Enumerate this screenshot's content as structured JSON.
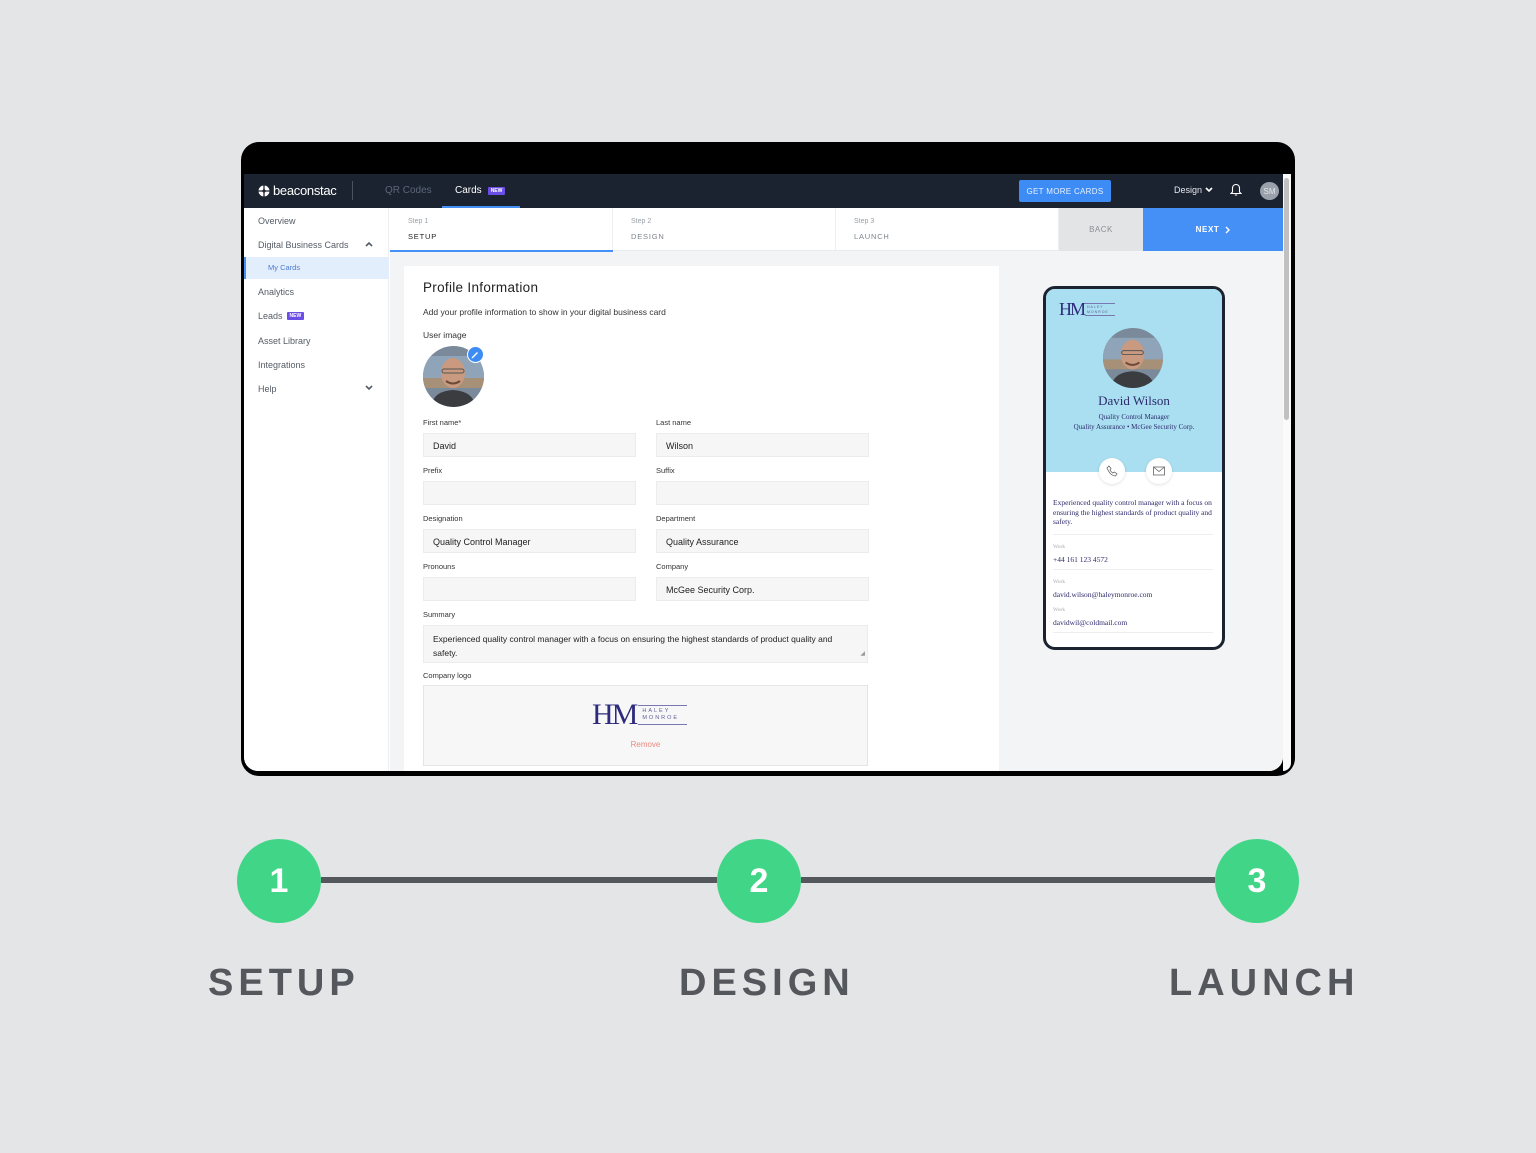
{
  "app": {
    "brand": "beaconstac",
    "nav_tabs": [
      {
        "label": "QR Codes",
        "active": false
      },
      {
        "label": "Cards",
        "active": true,
        "badge": "NEW"
      }
    ],
    "get_more_cards_label": "GET MORE CARDS",
    "workspace_dropdown": "Design",
    "user_initials": "SM",
    "accent_color": "#4590f7"
  },
  "sidebar": {
    "items": [
      {
        "label": "Overview"
      },
      {
        "label": "Digital Business Cards",
        "expanded": true
      },
      {
        "label": "My Cards",
        "active": true,
        "child": true
      },
      {
        "label": "Analytics"
      },
      {
        "label": "Leads",
        "badge": "NEW"
      },
      {
        "label": "Asset Library"
      },
      {
        "label": "Integrations"
      },
      {
        "label": "Help",
        "collapsed": true
      }
    ]
  },
  "wizard": {
    "steps": [
      {
        "num": "Step 1",
        "name": "SETUP",
        "active": true
      },
      {
        "num": "Step 2",
        "name": "DESIGN",
        "active": false
      },
      {
        "num": "Step 3",
        "name": "LAUNCH",
        "active": false
      }
    ],
    "back_label": "BACK",
    "next_label": "NEXT"
  },
  "form": {
    "title": "Profile Information",
    "subtitle": "Add your profile information to show in your digital business card",
    "user_image_label": "User image",
    "fields": {
      "first_name": {
        "label": "First name*",
        "value": "David"
      },
      "last_name": {
        "label": "Last name",
        "value": "Wilson"
      },
      "prefix": {
        "label": "Prefix",
        "value": ""
      },
      "suffix": {
        "label": "Suffix",
        "value": ""
      },
      "designation": {
        "label": "Designation",
        "value": "Quality Control Manager"
      },
      "department": {
        "label": "Department",
        "value": "Quality Assurance"
      },
      "pronouns": {
        "label": "Pronouns",
        "value": ""
      },
      "company": {
        "label": "Company",
        "value": "McGee Security Corp."
      }
    },
    "summary": {
      "label": "Summary",
      "value": "Experienced quality control manager with a focus on ensuring the highest standards of product quality and safety."
    },
    "company_logo": {
      "label": "Company logo",
      "logo_initials": "HM",
      "logo_line1": "HALEY",
      "logo_line2": "MONROE",
      "remove_label": "Remove"
    }
  },
  "preview": {
    "logo_initials": "HM",
    "logo_line1": "HALEY",
    "logo_line2": "MONROE",
    "name": "David Wilson",
    "designation": "Quality Control Manager",
    "org_line": "Quality Assurance • McGee Security Corp.",
    "summary": "Experienced quality control manager with a focus on ensuring the highest standards of product quality and safety.",
    "contacts": [
      {
        "type": "Work",
        "value": "+44 161 123 4572"
      },
      {
        "type": "Work",
        "value": "david.wilson@haleymonroe.com"
      },
      {
        "type": "Work",
        "value": "davidwil@coldmail.com"
      }
    ],
    "card_bg": "#a9dff0"
  },
  "process": {
    "steps": [
      {
        "number": "1",
        "label": "SETUP"
      },
      {
        "number": "2",
        "label": "DESIGN"
      },
      {
        "number": "3",
        "label": "LAUNCH"
      }
    ],
    "dot_color": "#41d587"
  }
}
